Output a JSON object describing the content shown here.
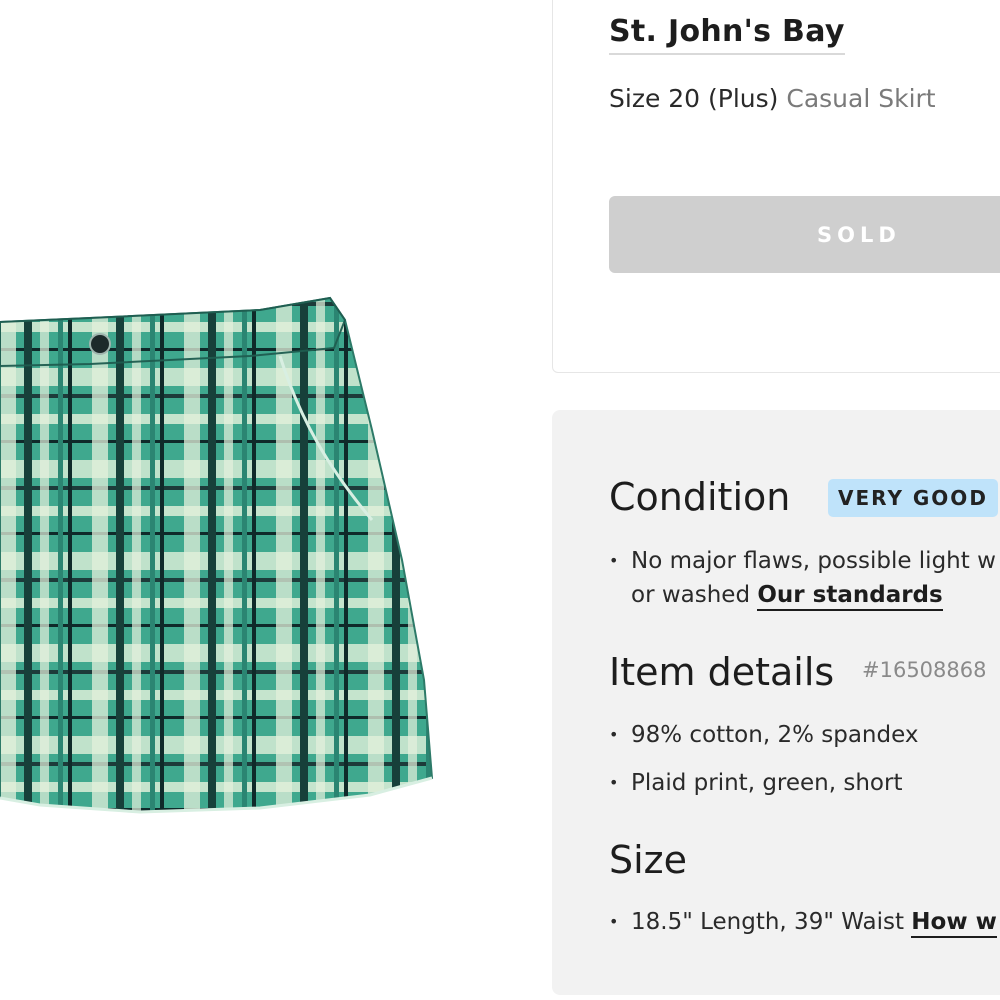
{
  "product": {
    "brand": "St. John's Bay",
    "size_label": "Size 20 (Plus)",
    "category": "Casual Skirt",
    "status_button": "SOLD",
    "image_icon": "plaid-skirt-photo",
    "colors": {
      "sold_button_bg": "#cfcfcf",
      "badge_bg": "#bfe3fa",
      "panel_bg": "#f2f2f2"
    }
  },
  "condition": {
    "title": "Condition",
    "badge": "VERY GOOD",
    "line1": "No major flaws, possible light w",
    "line2_prefix": "or washed ",
    "link": "Our standards"
  },
  "item_details": {
    "title": "Item details",
    "item_id": "#16508868",
    "bullets": [
      "98% cotton, 2% spandex",
      "Plaid print, green, short"
    ]
  },
  "size": {
    "title": "Size",
    "line_prefix": "18.5\" Length, 39\" Waist ",
    "link": "How w"
  },
  "bullet_glyph": "•"
}
